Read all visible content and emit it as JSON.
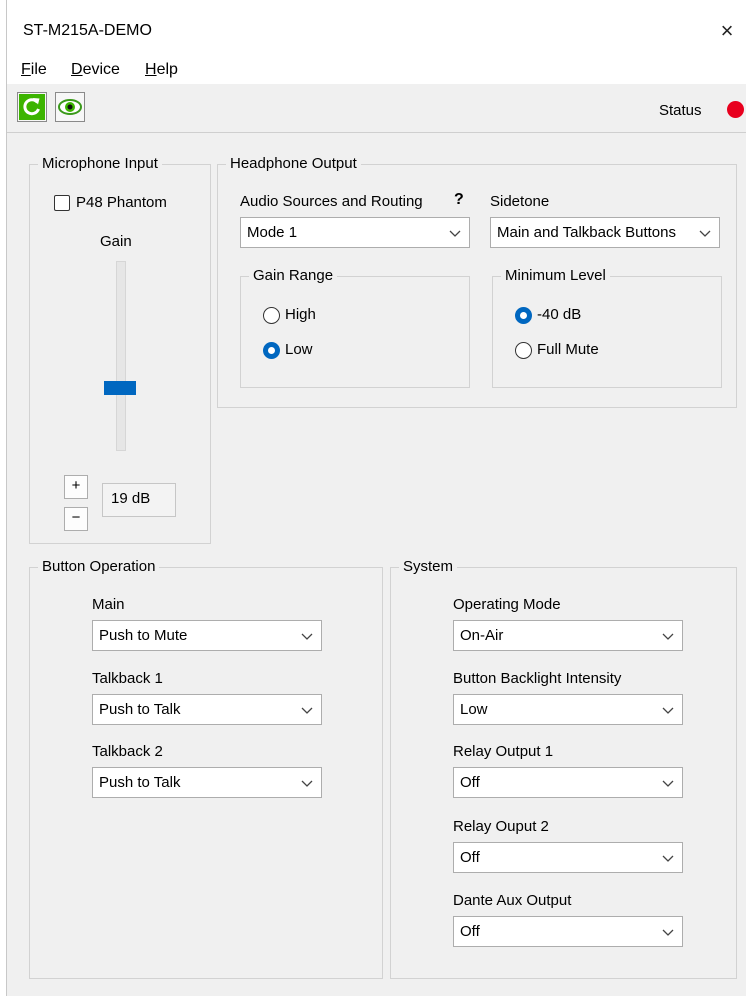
{
  "window": {
    "title": "ST-M215A-DEMO",
    "close_glyph": "×"
  },
  "menu": {
    "items": [
      {
        "accel": "F",
        "rest": "ile"
      },
      {
        "accel": "D",
        "rest": "evice"
      },
      {
        "accel": "H",
        "rest": "elp"
      }
    ]
  },
  "toolbar": {
    "refresh_icon": "refresh-icon",
    "monitor_icon": "eye-icon",
    "status_label": "Status",
    "status_color": "#e8001e",
    "accent_color": "#33aa00"
  },
  "microphone": {
    "title": "Microphone Input",
    "phantom_label": "P48 Phantom",
    "phantom_checked": false,
    "gain_label": "Gain",
    "gain_value": "19 dB",
    "gain_level": 0.32,
    "plus_label": "+",
    "minus_label": "−"
  },
  "headphone": {
    "title": "Headphone Output",
    "routing_label": "Audio Sources and Routing",
    "help_glyph": "?",
    "routing_value": "Mode 1",
    "sidetone_label": "Sidetone",
    "sidetone_value": "Main and Talkback Buttons",
    "gain_range": {
      "title": "Gain Range",
      "options": [
        "High",
        "Low"
      ],
      "selected": "Low"
    },
    "min_level": {
      "title": "Minimum Level",
      "options": [
        "-40 dB",
        "Full Mute"
      ],
      "selected": "-40 dB"
    }
  },
  "buttons": {
    "title": "Button Operation",
    "items": [
      {
        "label": "Main",
        "value": "Push to Mute"
      },
      {
        "label": "Talkback 1",
        "value": "Push to Talk"
      },
      {
        "label": "Talkback 2",
        "value": "Push to Talk"
      }
    ]
  },
  "system": {
    "title": "System",
    "items": [
      {
        "label": "Operating Mode",
        "value": "On-Air"
      },
      {
        "label": "Button Backlight Intensity",
        "value": "Low"
      },
      {
        "label": "Relay Output 1",
        "value": "Off"
      },
      {
        "label": "Relay Ouput 2",
        "value": "Off"
      },
      {
        "label": "Dante Aux Output",
        "value": "Off"
      }
    ]
  }
}
